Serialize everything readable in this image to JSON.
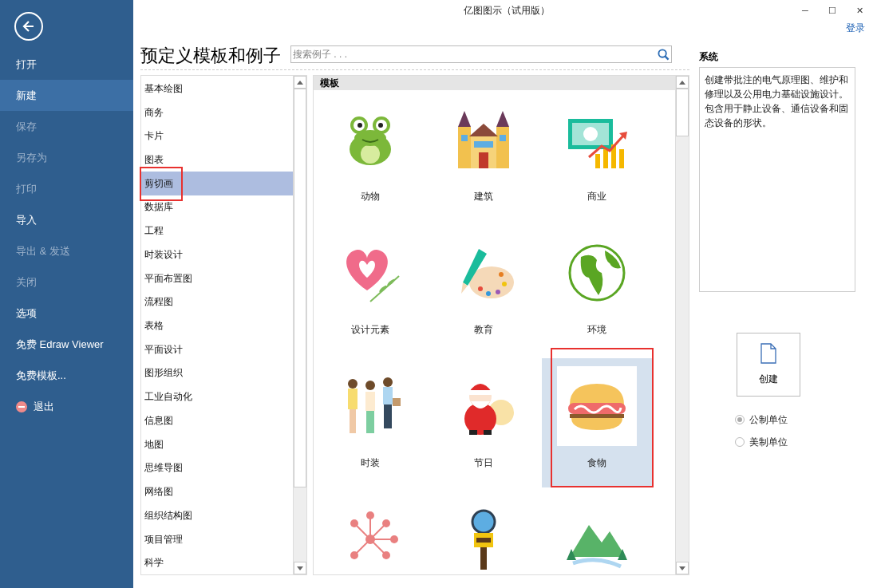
{
  "window": {
    "title": "亿图图示（试用版）",
    "controls": [
      "─",
      "☐",
      "✕"
    ],
    "login": "登录"
  },
  "sidebar": {
    "items": [
      {
        "label": "打开",
        "selected": false,
        "disabled": false,
        "kind": "text"
      },
      {
        "label": "新建",
        "selected": true,
        "disabled": false,
        "kind": "text"
      },
      {
        "label": "保存",
        "selected": false,
        "disabled": true,
        "kind": "text"
      },
      {
        "label": "另存为",
        "selected": false,
        "disabled": true,
        "kind": "text"
      },
      {
        "label": "打印",
        "selected": false,
        "disabled": true,
        "kind": "text"
      },
      {
        "label": "导入",
        "selected": false,
        "disabled": false,
        "kind": "text"
      },
      {
        "label": "导出 & 发送",
        "selected": false,
        "disabled": true,
        "kind": "text"
      },
      {
        "label": "关闭",
        "selected": false,
        "disabled": true,
        "kind": "text"
      },
      {
        "label": "选项",
        "selected": false,
        "disabled": false,
        "kind": "text"
      },
      {
        "label": "免费 Edraw Viewer",
        "selected": false,
        "disabled": false,
        "kind": "text"
      },
      {
        "label": "免费模板...",
        "selected": false,
        "disabled": false,
        "kind": "text"
      },
      {
        "label": "退出",
        "selected": false,
        "disabled": false,
        "kind": "exit"
      }
    ]
  },
  "heading": "预定义模板和例子",
  "search": {
    "placeholder": "搜索例子 . . ."
  },
  "categories": [
    {
      "label": "基本绘图",
      "selected": false
    },
    {
      "label": "商务",
      "selected": false
    },
    {
      "label": "卡片",
      "selected": false
    },
    {
      "label": "图表",
      "selected": false
    },
    {
      "label": "剪切画",
      "selected": true
    },
    {
      "label": "数据库",
      "selected": false
    },
    {
      "label": "工程",
      "selected": false
    },
    {
      "label": "时装设计",
      "selected": false
    },
    {
      "label": "平面布置图",
      "selected": false
    },
    {
      "label": "流程图",
      "selected": false
    },
    {
      "label": "表格",
      "selected": false
    },
    {
      "label": "平面设计",
      "selected": false
    },
    {
      "label": "图形组织",
      "selected": false
    },
    {
      "label": "工业自动化",
      "selected": false
    },
    {
      "label": "信息图",
      "selected": false
    },
    {
      "label": "地图",
      "selected": false
    },
    {
      "label": "思维导图",
      "selected": false
    },
    {
      "label": "网络图",
      "selected": false
    },
    {
      "label": "组织结构图",
      "selected": false
    },
    {
      "label": "项目管理",
      "selected": false
    },
    {
      "label": "科学",
      "selected": false
    }
  ],
  "templates": {
    "header": "模板",
    "items": [
      {
        "label": "动物",
        "selected": false
      },
      {
        "label": "建筑",
        "selected": false
      },
      {
        "label": "商业",
        "selected": false
      },
      {
        "label": "设计元素",
        "selected": false
      },
      {
        "label": "教育",
        "selected": false
      },
      {
        "label": "环境",
        "selected": false
      },
      {
        "label": "时装",
        "selected": false
      },
      {
        "label": "节日",
        "selected": false
      },
      {
        "label": "食物",
        "selected": true
      },
      {
        "selected": false
      },
      {
        "selected": false
      },
      {
        "selected": false
      }
    ]
  },
  "details": {
    "title": "系统",
    "description": "创建带批注的电气原理图、维护和修理以及公用电力基础设施设计。包含用于静止设备、通信设备和固态设备的形状。",
    "create_button": "创建",
    "units": [
      {
        "label": "公制单位",
        "selected": true
      },
      {
        "label": "美制单位",
        "selected": false
      }
    ]
  }
}
